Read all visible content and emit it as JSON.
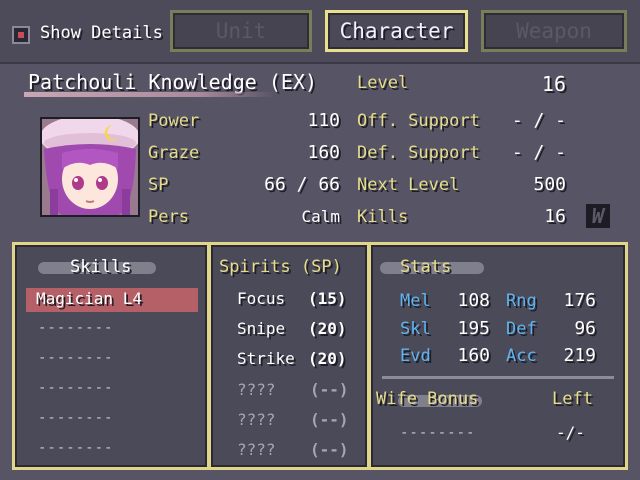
{
  "toolbar": {
    "show_details_label": "Show Details",
    "tabs": [
      {
        "label": "Unit",
        "state": "inactive"
      },
      {
        "label": "Character",
        "state": "active"
      },
      {
        "label": "Weapon",
        "state": "inactive"
      }
    ]
  },
  "character": {
    "name": "Patchouli Knowledge (EX)",
    "power_label": "Power",
    "power": "110",
    "graze_label": "Graze",
    "graze": "160",
    "sp_label": "SP",
    "sp": "66 / 66",
    "pers_label": "Pers",
    "pers": "Calm",
    "level_label": "Level",
    "level": "16",
    "off_support_label": "Off. Support",
    "off_support": "- / -",
    "def_support_label": "Def. Support",
    "def_support": "- / -",
    "next_level_label": "Next Level",
    "next_level": "500",
    "kills_label": "Kills",
    "kills": "16",
    "rank_badge": "W"
  },
  "skills": {
    "title": "Skills",
    "items": [
      "Magician L4",
      "--------",
      "--------",
      "--------",
      "--------",
      "--------"
    ]
  },
  "spirits": {
    "title": "Spirits (SP)",
    "items": [
      {
        "name": "Focus",
        "cost": "(15)"
      },
      {
        "name": "Snipe",
        "cost": "(20)"
      },
      {
        "name": "Strike",
        "cost": "(20)"
      },
      {
        "name": "????",
        "cost": "(--)"
      },
      {
        "name": "????",
        "cost": "(--)"
      },
      {
        "name": "????",
        "cost": "(--)"
      }
    ]
  },
  "stats": {
    "title": "Stats",
    "mel_label": "Mel",
    "mel": "108",
    "rng_label": "Rng",
    "rng": "176",
    "skl_label": "Skl",
    "skl": "195",
    "def_label": "Def",
    "def": "96",
    "evd_label": "Evd",
    "evd": "160",
    "acc_label": "Acc",
    "acc": "219",
    "wife_bonus_label": "Wife Bonus",
    "left_label": "Left",
    "wife_bonus_value": "--------",
    "left_value": "-/-"
  },
  "colors": {
    "accent_gold": "#e5dc8c",
    "stat_blue": "#5fb4ef",
    "highlight_red": "#b56067",
    "background": "#575565"
  }
}
